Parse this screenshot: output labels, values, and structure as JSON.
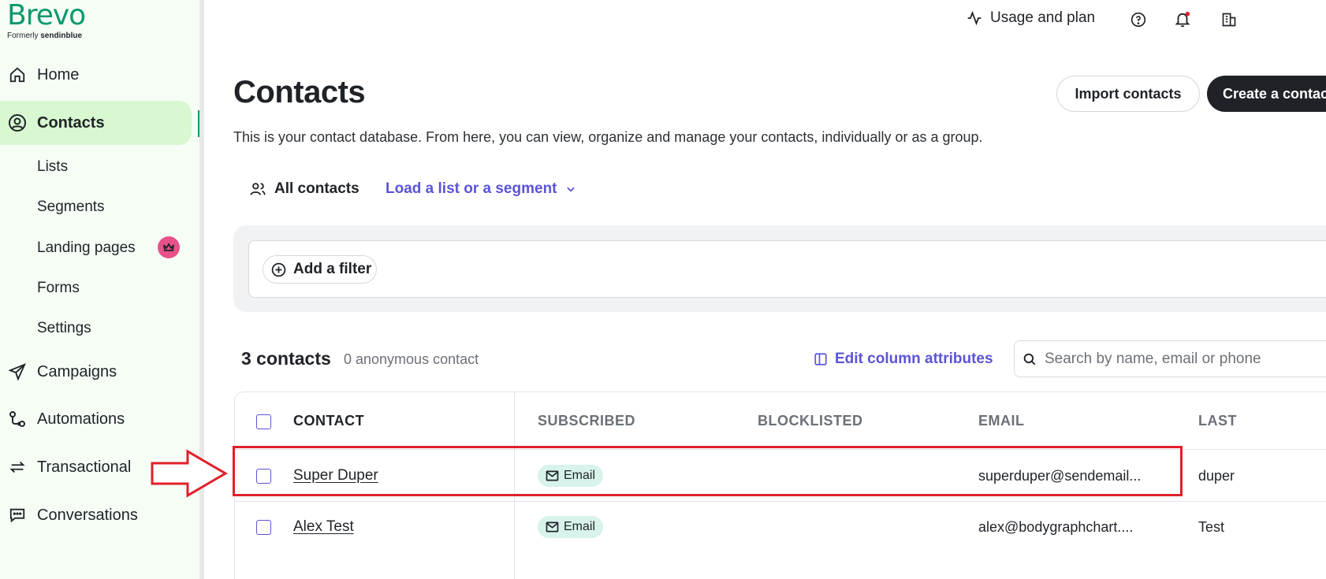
{
  "brand": {
    "name": "Brevo",
    "formerly_prefix": "Formerly",
    "formerly_name": "sendinblue"
  },
  "sidebar": {
    "items": [
      {
        "label": "Home",
        "icon": "home-icon"
      },
      {
        "label": "Contacts",
        "icon": "contacts-icon",
        "active": true
      },
      {
        "label": "Campaigns",
        "icon": "send-icon"
      },
      {
        "label": "Automations",
        "icon": "automations-icon"
      },
      {
        "label": "Transactional",
        "icon": "transactional-icon"
      },
      {
        "label": "Conversations",
        "icon": "chat-icon"
      }
    ],
    "sub_items": [
      {
        "label": "Lists"
      },
      {
        "label": "Segments"
      },
      {
        "label": "Landing pages",
        "badge": "crown-icon"
      },
      {
        "label": "Forms"
      },
      {
        "label": "Settings"
      }
    ]
  },
  "topbar": {
    "usage_label": "Usage and plan",
    "icons": [
      "help-icon",
      "notifications-icon",
      "company-icon"
    ]
  },
  "main": {
    "title": "Contacts",
    "import_label": "Import contacts",
    "create_label": "Create a contact",
    "description": "This is your contact database. From here, you can view, organize and manage your contacts, individually or as a group.",
    "all_contacts_label": "All contacts",
    "load_list_label": "Load a list or a segment",
    "add_filter_label": "Add a filter",
    "count_label": "3 contacts",
    "anon_label": "0 anonymous contact",
    "edit_columns_label": "Edit column attributes",
    "search_placeholder": "Search by name, email or phone"
  },
  "table": {
    "headers": [
      "CONTACT",
      "SUBSCRIBED",
      "BLOCKLISTED",
      "EMAIL",
      "LAST"
    ],
    "rows": [
      {
        "contact": "Super Duper",
        "subscribed": "Email",
        "blocklisted": "",
        "email": "superduper@sendemail...",
        "last": "duper"
      },
      {
        "contact": "Alex Test",
        "subscribed": "Email",
        "blocklisted": "",
        "email": "alex@bodygraphchart....",
        "last": "Test"
      }
    ]
  },
  "colors": {
    "brand_green": "#0b996e",
    "active_bg": "#d7f8d0",
    "accent_purple": "#5a54d6",
    "highlight_red": "#e0202a",
    "badge_pink": "#e8518a"
  }
}
